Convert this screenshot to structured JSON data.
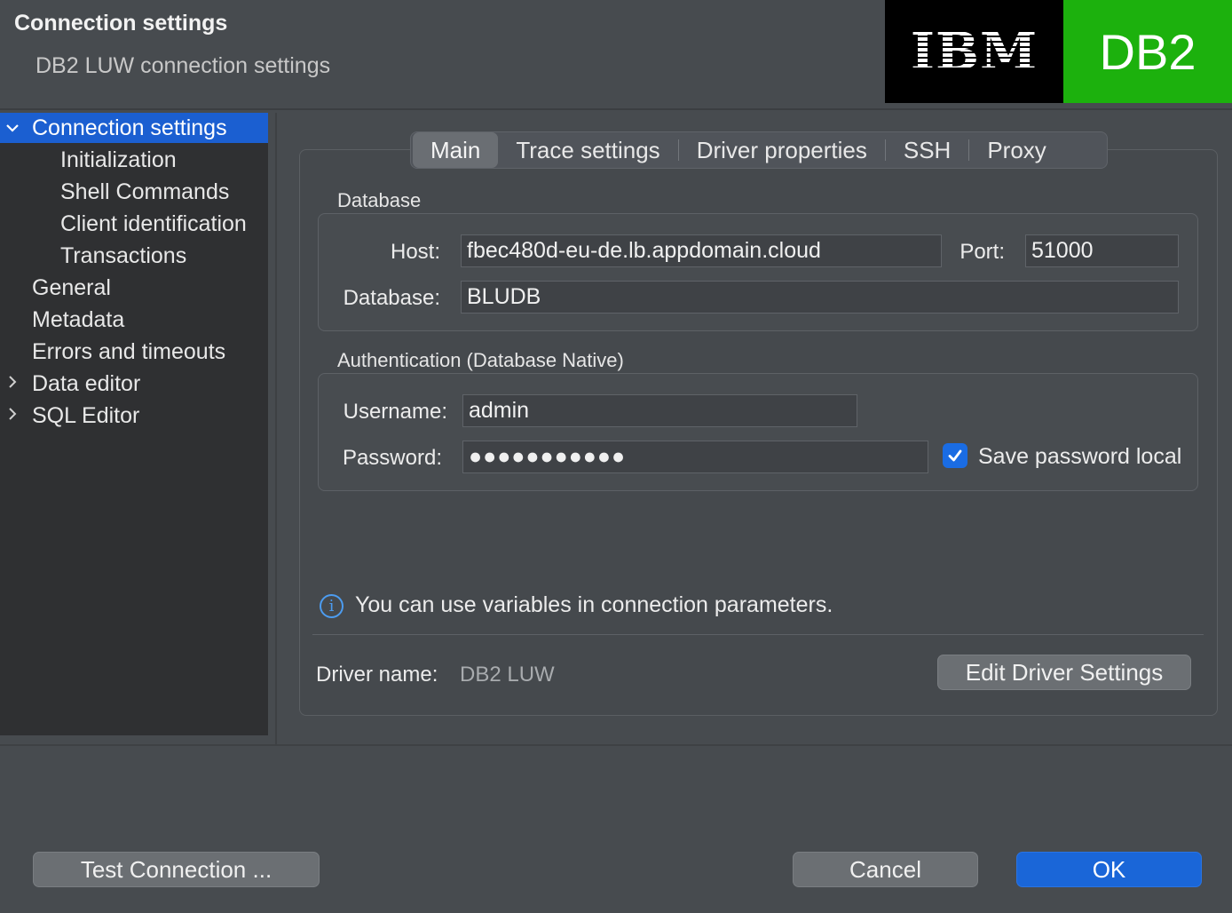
{
  "header": {
    "title": "Connection settings",
    "subtitle": "DB2 LUW connection settings",
    "logo_ibm": "IBM",
    "logo_db2": "DB2",
    "colors": {
      "ibm_bg": "#000000",
      "db2_bg": "#1cb10d"
    }
  },
  "tree": {
    "items": [
      {
        "label": "Connection settings",
        "chevron": "⌄"
      },
      {
        "label": "Initialization"
      },
      {
        "label": "Shell Commands"
      },
      {
        "label": "Client identification"
      },
      {
        "label": "Transactions"
      },
      {
        "label": "General"
      },
      {
        "label": "Metadata"
      },
      {
        "label": "Errors and timeouts"
      },
      {
        "label": "Data editor",
        "chevron": "›"
      },
      {
        "label": "SQL Editor",
        "chevron": "›"
      }
    ]
  },
  "tabs": [
    "Main",
    "Trace settings",
    "Driver properties",
    "SSH",
    "Proxy"
  ],
  "database": {
    "group_label": "Database",
    "host_label": "Host:",
    "host_value": "fbec480d-eu-de.lb.appdomain.cloud",
    "port_label": "Port:",
    "port_value": "51000",
    "database_label": "Database:",
    "database_value": "BLUDB"
  },
  "auth": {
    "group_label": "Authentication (Database Native)",
    "username_label": "Username:",
    "username_value": "admin",
    "password_label": "Password:",
    "password_value": "●●●●●●●●●●●",
    "save_password_label": "Save password locally",
    "save_password_checked": true
  },
  "info": {
    "text": "You can use variables in connection parameters."
  },
  "driver": {
    "label": "Driver name:",
    "value": "DB2 LUW",
    "edit_button": "Edit Driver Settings"
  },
  "footer": {
    "test_button": "Test Connection ...",
    "cancel_button": "Cancel",
    "ok_button": "OK"
  },
  "colors": {
    "accent": "#1b5fd1",
    "info": "#4c9cf0"
  }
}
